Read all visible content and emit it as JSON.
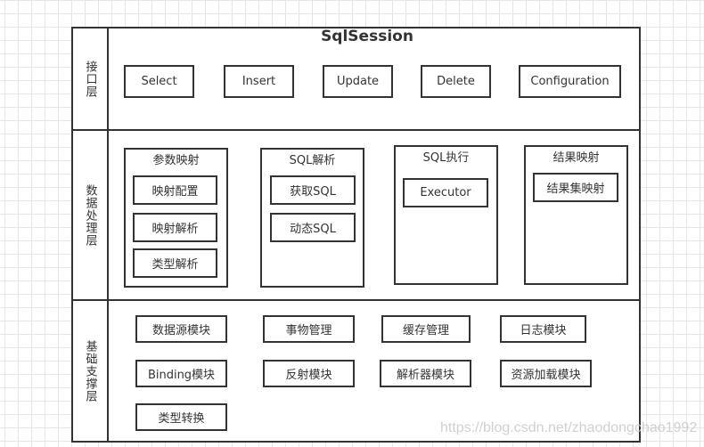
{
  "diagram": {
    "title": "SqlSession",
    "layers": [
      {
        "label": "接口层",
        "items": [
          "Select",
          "Insert",
          "Update",
          "Delete",
          "Configuration"
        ]
      },
      {
        "label": "数据处理层",
        "groups": [
          {
            "title": "参数映射",
            "items": [
              "映射配置",
              "映射解析",
              "类型解析"
            ]
          },
          {
            "title": "SQL解析",
            "items": [
              "获取SQL",
              "动态SQL"
            ]
          },
          {
            "title": "SQL执行",
            "items": [
              "Executor"
            ]
          },
          {
            "title": "结果映射",
            "items": [
              "结果集映射"
            ]
          }
        ]
      },
      {
        "label": "基础支撑层",
        "items": [
          "数据源模块",
          "事物管理",
          "缓存管理",
          "日志模块",
          "Binding模块",
          "反射模块",
          "解析器模块",
          "资源加载模块",
          "类型转换"
        ]
      }
    ]
  },
  "watermark": "https://blog.csdn.net/zhaodongchao1992",
  "colors": {
    "stroke": "#333333",
    "grid": "#e6e6e6",
    "background": "#ffffff"
  }
}
